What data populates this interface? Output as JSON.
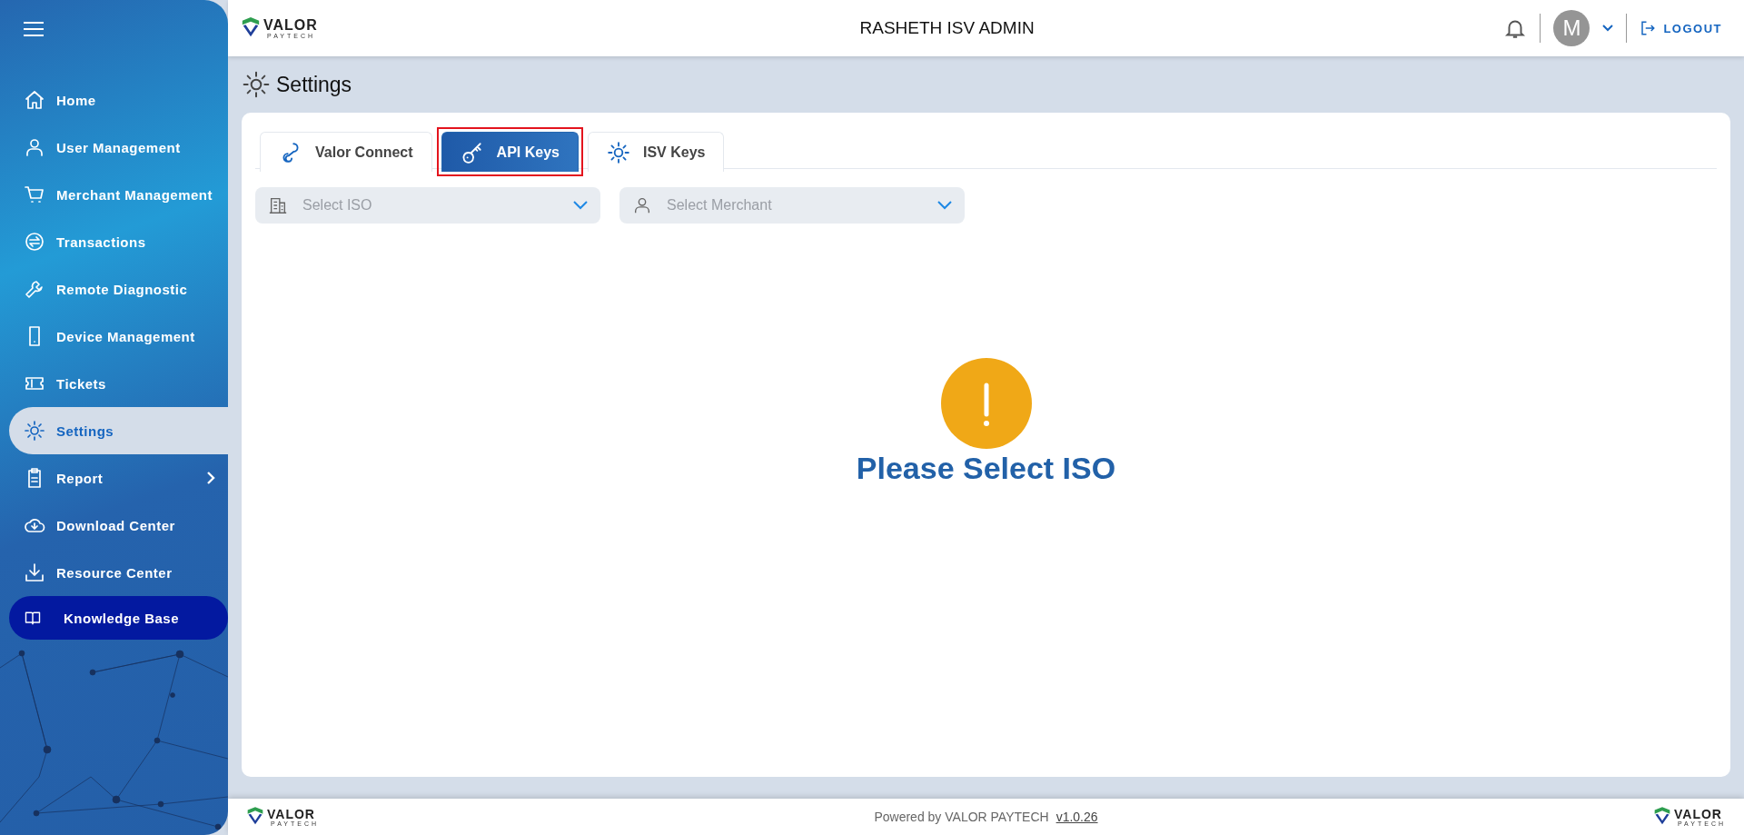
{
  "header": {
    "logo": {
      "name": "VALOR",
      "sub": "PAYTECH"
    },
    "title": "RASHETH ISV ADMIN",
    "avatar": "M",
    "logout": "LOGOUT"
  },
  "sidebar": {
    "items": [
      {
        "label": "Home",
        "kind": "item",
        "selected": false
      },
      {
        "label": "User Management",
        "kind": "item",
        "selected": false
      },
      {
        "label": "Merchant Management",
        "kind": "item",
        "selected": false
      },
      {
        "label": "Transactions",
        "kind": "item",
        "selected": false
      },
      {
        "label": "Remote Diagnostic",
        "kind": "item",
        "selected": false
      },
      {
        "label": "Device Management",
        "kind": "item",
        "selected": false
      },
      {
        "label": "Tickets",
        "kind": "item",
        "selected": false
      },
      {
        "label": "Settings",
        "kind": "item",
        "selected": true
      },
      {
        "label": "Report",
        "kind": "submenu",
        "selected": false
      },
      {
        "label": "Download Center",
        "kind": "item",
        "selected": false
      },
      {
        "label": "Resource Center",
        "kind": "item",
        "selected": false
      },
      {
        "label": "Knowledge Base",
        "kind": "featured",
        "selected": false
      }
    ]
  },
  "page": {
    "title": "Settings"
  },
  "tabs": [
    {
      "label": "Valor Connect",
      "selected": false
    },
    {
      "label": "API Keys",
      "selected": true
    },
    {
      "label": "ISV Keys",
      "selected": false
    }
  ],
  "filters": [
    {
      "placeholder": "Select ISO"
    },
    {
      "placeholder": "Select Merchant"
    }
  ],
  "empty_state": {
    "message": "Please Select ISO"
  },
  "footer": {
    "logo_left": {
      "name": "VALOR",
      "sub": "PAYTECH"
    },
    "text": "Powered by VALOR PAYTECH",
    "version": "v1.0.26",
    "logo_right": {
      "name": "VALOR",
      "sub": "PAYTECH"
    }
  }
}
